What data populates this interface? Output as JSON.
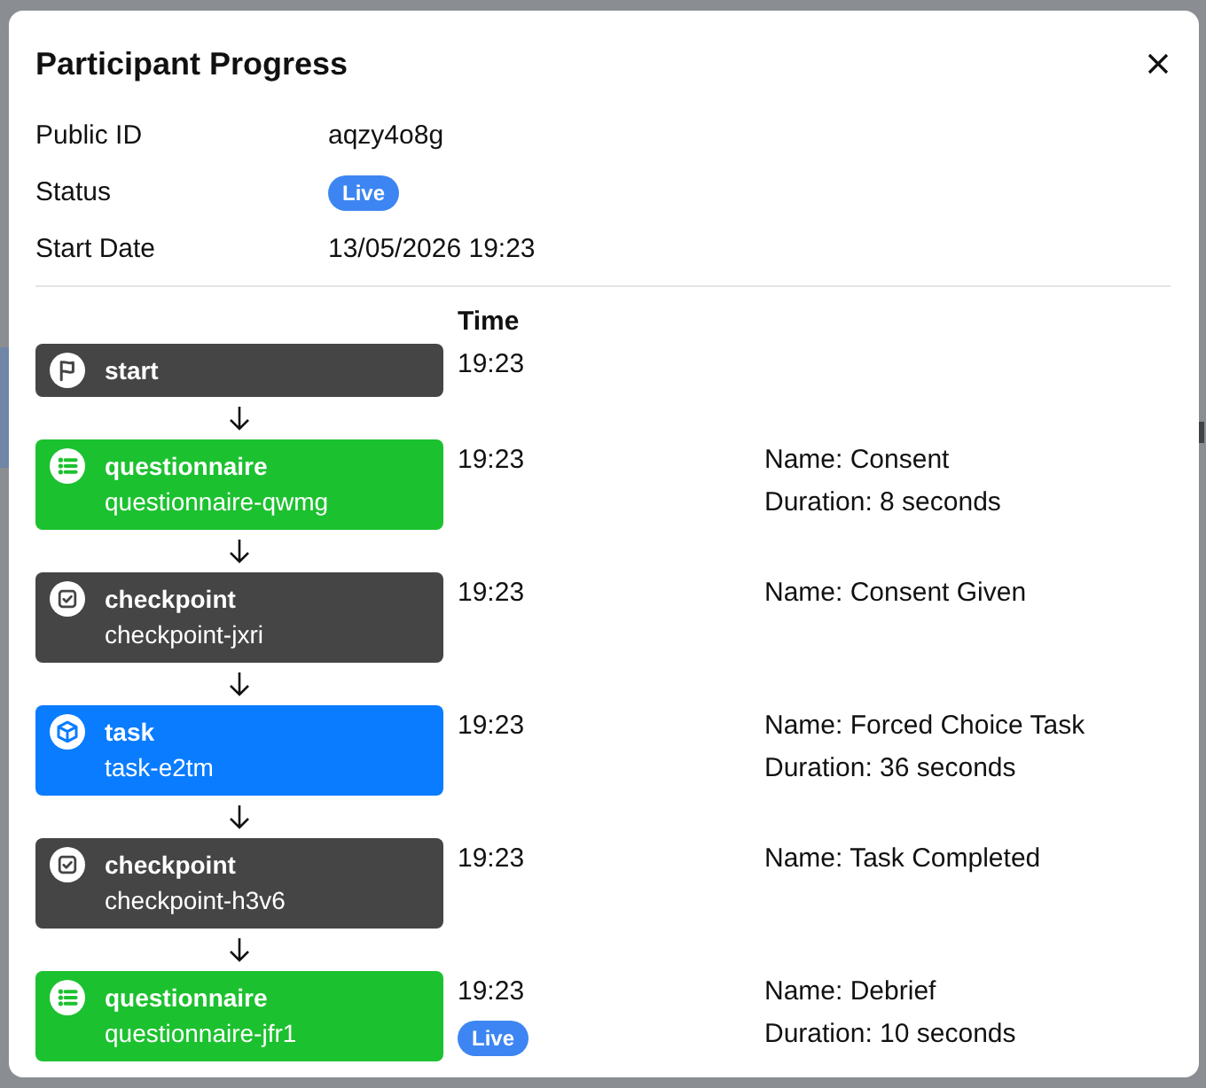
{
  "dialog": {
    "title": "Participant Progress",
    "fields": [
      {
        "kind": "text",
        "label": "Public ID",
        "value": "aqzy4o8g"
      },
      {
        "kind": "badge",
        "label": "Status",
        "value": "Live"
      },
      {
        "kind": "text",
        "label": "Start Date",
        "value": "13/05/2026 19:23"
      }
    ],
    "timeline": {
      "time_header": "Time",
      "steps": [
        {
          "kind": "start",
          "title": "start",
          "time": "19:23"
        },
        {
          "kind": "questionnaire",
          "title": "questionnaire",
          "id": "questionnaire-qwmg",
          "time": "19:23",
          "details": [
            "Name: Consent",
            "Duration: 8 seconds"
          ]
        },
        {
          "kind": "checkpoint",
          "title": "checkpoint",
          "id": "checkpoint-jxri",
          "time": "19:23",
          "details": [
            "Name: Consent Given"
          ]
        },
        {
          "kind": "task",
          "title": "task",
          "id": "task-e2tm",
          "time": "19:23",
          "details": [
            "Name: Forced Choice Task",
            "Duration: 36 seconds"
          ]
        },
        {
          "kind": "checkpoint",
          "title": "checkpoint",
          "id": "checkpoint-h3v6",
          "time": "19:23",
          "details": [
            "Name: Task Completed"
          ]
        },
        {
          "kind": "questionnaire",
          "title": "questionnaire",
          "id": "questionnaire-jfr1",
          "time": "19:23",
          "badge": "Live",
          "details": [
            "Name: Debrief",
            "Duration: 10 seconds"
          ]
        }
      ]
    }
  }
}
